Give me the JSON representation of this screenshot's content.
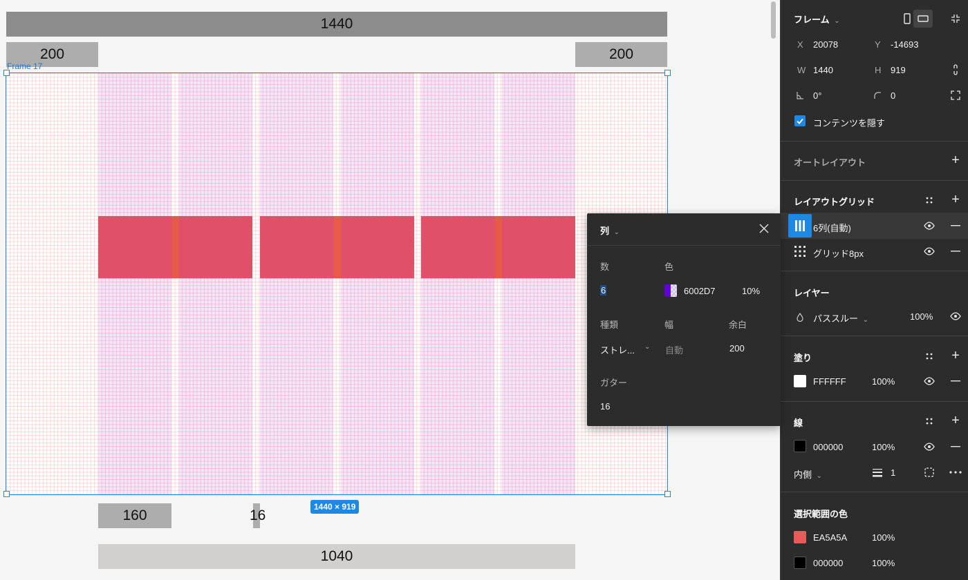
{
  "canvas": {
    "measures": {
      "total_width": "1440",
      "margin_left": "200",
      "margin_right": "200",
      "column_width": "160",
      "gutter": "16",
      "content_width": "1040"
    },
    "frame_name": "Frame 17",
    "size_badge": "1440 × 919"
  },
  "popup": {
    "title": "列",
    "count_label": "数",
    "count_value": "6",
    "color_label": "色",
    "color_hex": "6002D7",
    "color_opacity": "10%",
    "type_label": "種類",
    "type_value": "ストレ...",
    "width_label": "幅",
    "width_value": "自動",
    "margin_label": "余白",
    "margin_value": "200",
    "gutter_label": "ガター",
    "gutter_value": "16",
    "swatch_color": "#6002D7"
  },
  "panel": {
    "frame_title": "フレーム",
    "x_label": "X",
    "x_value": "20078",
    "y_label": "Y",
    "y_value": "-14693",
    "w_label": "W",
    "w_value": "1440",
    "h_label": "H",
    "h_value": "919",
    "rotation_value": "0°",
    "radius_value": "0",
    "clip_content_label": "コンテンツを隠す",
    "auto_layout_title": "オートレイアウト",
    "layout_grid_title": "レイアウトグリッド",
    "grids": [
      {
        "label": "6列(自動)"
      },
      {
        "label": "グリッド8px"
      }
    ],
    "layer_title": "レイヤー",
    "blend_mode": "パススルー",
    "layer_opacity": "100%",
    "fill_title": "塗り",
    "fill_hex": "FFFFFF",
    "fill_opacity": "100%",
    "fill_color": "#FFFFFF",
    "stroke_title": "線",
    "stroke_hex": "000000",
    "stroke_opacity": "100%",
    "stroke_color": "#000000",
    "stroke_position": "内側",
    "stroke_weight": "1",
    "selection_colors_title": "選択範囲の色",
    "selection_colors": [
      {
        "hex": "EA5A5A",
        "opacity": "100%",
        "color": "#EA5A5A"
      },
      {
        "hex": "000000",
        "opacity": "100%",
        "color": "#000000"
      }
    ]
  }
}
